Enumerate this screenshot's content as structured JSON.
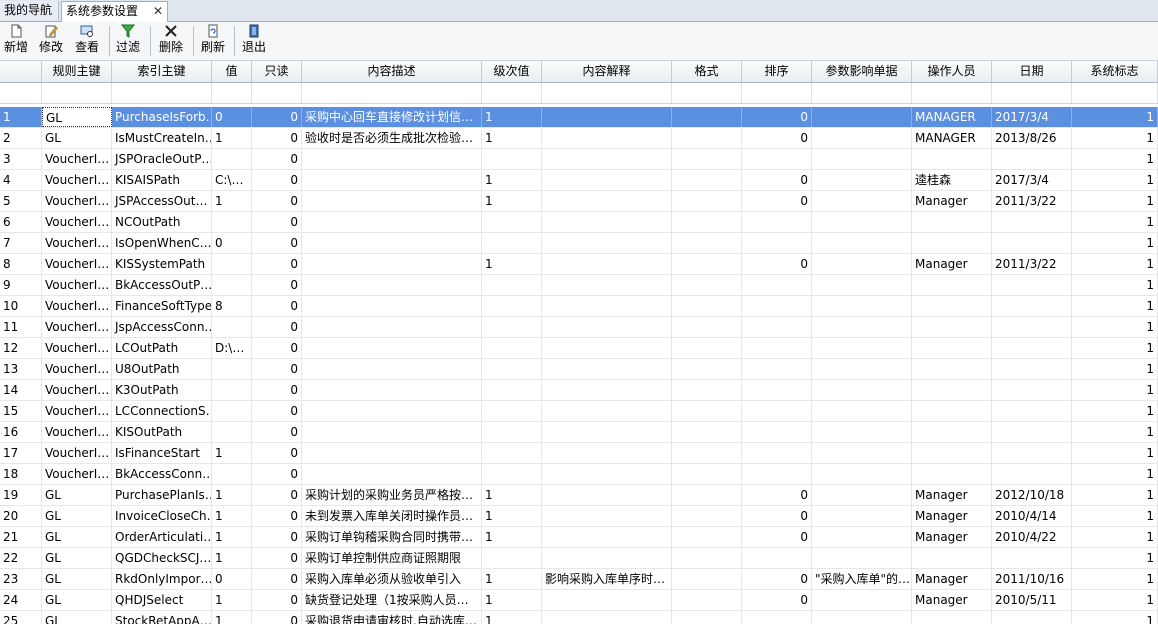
{
  "tabs": {
    "nav_label": "我的导航",
    "active_label": "系统参数设置",
    "close_glyph": "✕"
  },
  "toolbar": {
    "new_label": "新增",
    "edit_label": "修改",
    "view_label": "查看",
    "filter_label": "过滤",
    "delete_label": "删除",
    "refresh_label": "刷新",
    "exit_label": "退出"
  },
  "columns": [
    "规则主键",
    "索引主键",
    "值",
    "只读",
    "内容描述",
    "级次值",
    "内容解释",
    "格式",
    "排序",
    "参数影响单据",
    "操作人员",
    "日期",
    "系统标志"
  ],
  "rows": [
    [
      "1",
      "GL",
      "PurchaseIsForb…",
      "0",
      "0",
      "采购中心回车直接修改计划信…",
      "1",
      "",
      "",
      "0",
      "",
      "MANAGER",
      "2017/3/4",
      "1"
    ],
    [
      "2",
      "GL",
      "IsMustCreateIn…",
      "1",
      "0",
      "验收时是否必须生成批次检验…",
      "1",
      "",
      "",
      "0",
      "",
      "MANAGER",
      "2013/8/26",
      "1"
    ],
    [
      "3",
      "VoucherI…",
      "JSPOracleOutP…",
      "",
      "0",
      "",
      "",
      "",
      "",
      "",
      "",
      "",
      "",
      "1"
    ],
    [
      "4",
      "VoucherI…",
      "KISAISPath",
      "C:\\…",
      "0",
      "",
      "1",
      "",
      "",
      "0",
      "",
      "逵桂森",
      "2017/3/4",
      "1"
    ],
    [
      "5",
      "VoucherI…",
      "JSPAccessOut…",
      "1",
      "0",
      "",
      "1",
      "",
      "",
      "0",
      "",
      "Manager",
      "2011/3/22",
      "1"
    ],
    [
      "6",
      "VoucherI…",
      "NCOutPath",
      "",
      "0",
      "",
      "",
      "",
      "",
      "",
      "",
      "",
      "",
      "1"
    ],
    [
      "7",
      "VoucherI…",
      "IsOpenWhenC…",
      "0",
      "0",
      "",
      "",
      "",
      "",
      "",
      "",
      "",
      "",
      "1"
    ],
    [
      "8",
      "VoucherI…",
      "KISSystemPath",
      "",
      "0",
      "",
      "1",
      "",
      "",
      "0",
      "",
      "Manager",
      "2011/3/22",
      "1"
    ],
    [
      "9",
      "VoucherI…",
      "BkAccessOutP…",
      "",
      "0",
      "",
      "",
      "",
      "",
      "",
      "",
      "",
      "",
      "1"
    ],
    [
      "10",
      "VoucherI…",
      "FinanceSoftType",
      "8",
      "0",
      "",
      "",
      "",
      "",
      "",
      "",
      "",
      "",
      "1"
    ],
    [
      "11",
      "VoucherI…",
      "JspAccessConn…",
      "",
      "0",
      "",
      "",
      "",
      "",
      "",
      "",
      "",
      "",
      "1"
    ],
    [
      "12",
      "VoucherI…",
      "LCOutPath",
      "D:\\…",
      "0",
      "",
      "",
      "",
      "",
      "",
      "",
      "",
      "",
      "1"
    ],
    [
      "13",
      "VoucherI…",
      "U8OutPath",
      "",
      "0",
      "",
      "",
      "",
      "",
      "",
      "",
      "",
      "",
      "1"
    ],
    [
      "14",
      "VoucherI…",
      "K3OutPath",
      "",
      "0",
      "",
      "",
      "",
      "",
      "",
      "",
      "",
      "",
      "1"
    ],
    [
      "15",
      "VoucherI…",
      "LCConnectionS…",
      "",
      "0",
      "",
      "",
      "",
      "",
      "",
      "",
      "",
      "",
      "1"
    ],
    [
      "16",
      "VoucherI…",
      "KISOutPath",
      "",
      "0",
      "",
      "",
      "",
      "",
      "",
      "",
      "",
      "",
      "1"
    ],
    [
      "17",
      "VoucherI…",
      "IsFinanceStart",
      "1",
      "0",
      "",
      "",
      "",
      "",
      "",
      "",
      "",
      "",
      "1"
    ],
    [
      "18",
      "VoucherI…",
      "BkAccessConn…",
      "",
      "0",
      "",
      "",
      "",
      "",
      "",
      "",
      "",
      "",
      "1"
    ],
    [
      "19",
      "GL",
      "PurchasePlanIs…",
      "1",
      "0",
      "采购计划的采购业务员严格按…",
      "1",
      "",
      "",
      "0",
      "",
      "Manager",
      "2012/10/18",
      "1"
    ],
    [
      "20",
      "GL",
      "InvoiceCloseCh…",
      "1",
      "0",
      "未到发票入库单关闭时操作员…",
      "1",
      "",
      "",
      "0",
      "",
      "Manager",
      "2010/4/14",
      "1"
    ],
    [
      "21",
      "GL",
      "OrderArticulati…",
      "1",
      "0",
      "采购订单钩稽采购合同时携带…",
      "1",
      "",
      "",
      "0",
      "",
      "Manager",
      "2010/4/22",
      "1"
    ],
    [
      "22",
      "GL",
      "QGDCheckSCJ…",
      "1",
      "0",
      "采购订单控制供应商证照期限",
      "",
      "",
      "",
      "",
      "",
      "",
      "",
      "1"
    ],
    [
      "23",
      "GL",
      "RkdOnlyImpor…",
      "0",
      "0",
      "采购入库单必须从验收单引入",
      "1",
      "影响采购入库单序时…",
      "",
      "0",
      "\"采购入库单\"的…",
      "Manager",
      "2011/10/16",
      "1"
    ],
    [
      "24",
      "GL",
      "QHDJSelect",
      "1",
      "0",
      "缺货登记处理（1按采购人员…",
      "1",
      "",
      "",
      "0",
      "",
      "Manager",
      "2010/5/11",
      "1"
    ],
    [
      "25",
      "GL",
      "StockRetAppA…",
      "1",
      "0",
      "采购退货申请审核时,自动选库…",
      "1",
      "",
      "",
      "",
      "",
      "",
      "",
      "1"
    ]
  ],
  "selected_row": 0
}
